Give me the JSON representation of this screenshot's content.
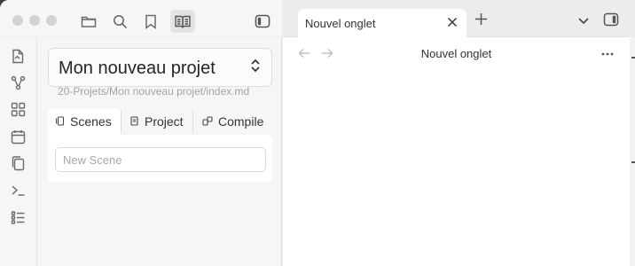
{
  "titlebar": {
    "icons": [
      "folder-icon",
      "search-icon",
      "bookmark-icon",
      "reading-icon",
      "sidebar-toggle-icon"
    ]
  },
  "ribbon": {
    "icons": [
      "open-file-icon",
      "graph-icon",
      "canvas-icon",
      "calendar-icon",
      "copy-icon",
      "terminal-icon",
      "outline-icon"
    ]
  },
  "sidebar": {
    "project_title": "Mon nouveau projet",
    "project_path": "20-Projets/Mon nouveau projet/index.md",
    "tabs": [
      {
        "label": "Scenes",
        "icon": "scenes-icon"
      },
      {
        "label": "Project",
        "icon": "document-icon"
      },
      {
        "label": "Compile",
        "icon": "compile-icon"
      }
    ],
    "active_tab": "Scenes",
    "new_scene_placeholder": "New Scene"
  },
  "tabbar": {
    "tab_label": "Nouvel onglet",
    "icons": [
      "close-icon",
      "new-tab-icon",
      "chevron-down-icon",
      "right-sidebar-icon"
    ]
  },
  "content": {
    "title": "Nouvel onglet",
    "icons": [
      "back-arrow-icon",
      "forward-arrow-icon",
      "more-options-icon"
    ]
  }
}
